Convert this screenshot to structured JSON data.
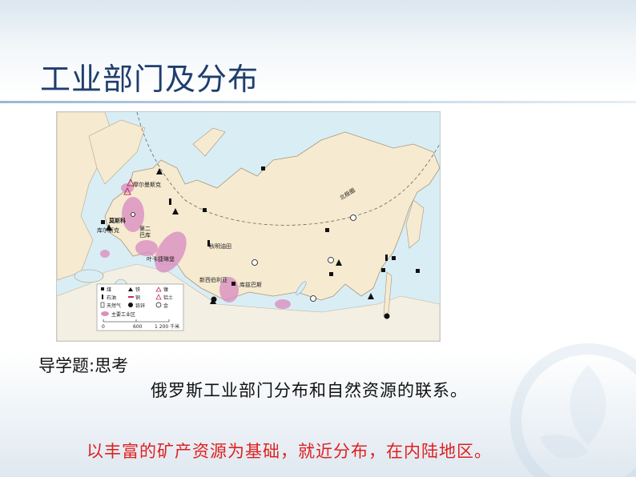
{
  "slide": {
    "title": "工业部门及分布",
    "question_label": "导学题:思考",
    "question_text": "俄罗斯工业部门分布和自然资源的联系。",
    "answer_text": "以丰富的矿产资源为基础，就近分布，在内陆地区。"
  },
  "map": {
    "labels": {
      "arctic_circle": "北极圈",
      "murmansk": "摩尔曼斯克",
      "moscow": "莫斯科",
      "kursk": "库尔斯克",
      "second_baku_1": "第二",
      "second_baku_2": "巴库",
      "yekaterinburg": "叶卡捷琳堡",
      "tyumen": "秋明油田",
      "novosibirsk": "新西伯利亚",
      "kuzbass": "库兹巴斯"
    },
    "legend": {
      "coal": "煤",
      "iron": "铁",
      "nickel": "镍",
      "oil": "石油",
      "copper": "铜",
      "bauxite": "铝土",
      "gas": "天然气",
      "lead_zinc": "铅锌",
      "gold": "金",
      "industrial_zone": "主要工业区",
      "scale_0": "0",
      "scale_600": "600",
      "scale_1200": "1 200 千米"
    }
  },
  "colors": {
    "title": "#1f3e6e",
    "answer": "#e02020",
    "land": "#f6ead0",
    "water": "#d9edf5",
    "industrial_zone": "#d98fc0"
  }
}
